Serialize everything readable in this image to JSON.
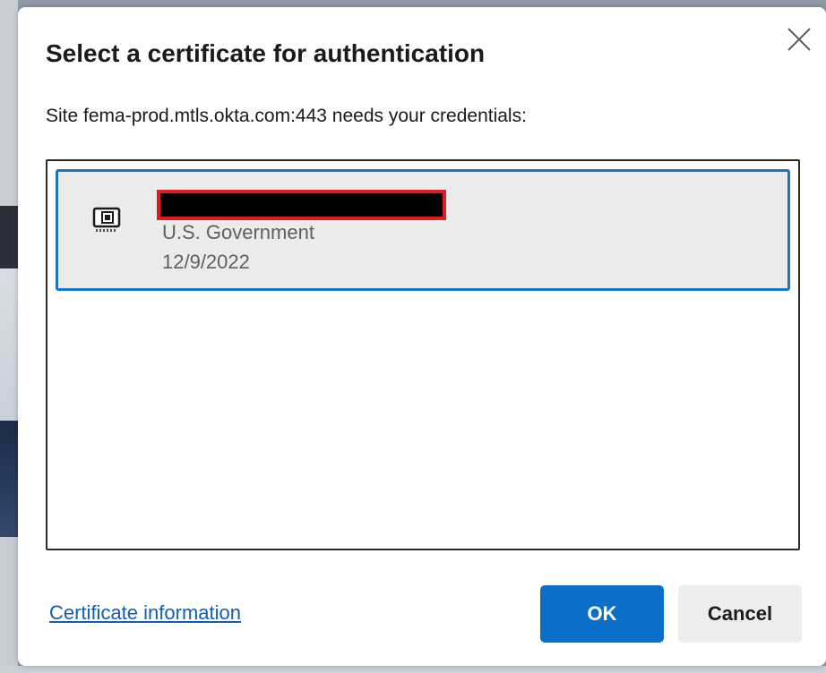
{
  "dialog": {
    "title": "Select a certificate for authentication",
    "subtitle": "Site fema-prod.mtls.okta.com:443 needs your credentials:",
    "close_icon": "close-icon"
  },
  "certificates": [
    {
      "name": "",
      "name_redacted": true,
      "issuer": "U.S. Government",
      "date": "12/9/2022",
      "icon": "certificate-chip-icon",
      "selected": true
    }
  ],
  "footer": {
    "info_link": "Certificate information",
    "ok_label": "OK",
    "cancel_label": "Cancel"
  },
  "colors": {
    "accent": "#0a6fc9",
    "link": "#0f5fb5",
    "selection_border": "#1a73c9",
    "redaction_border": "#e11b22"
  }
}
